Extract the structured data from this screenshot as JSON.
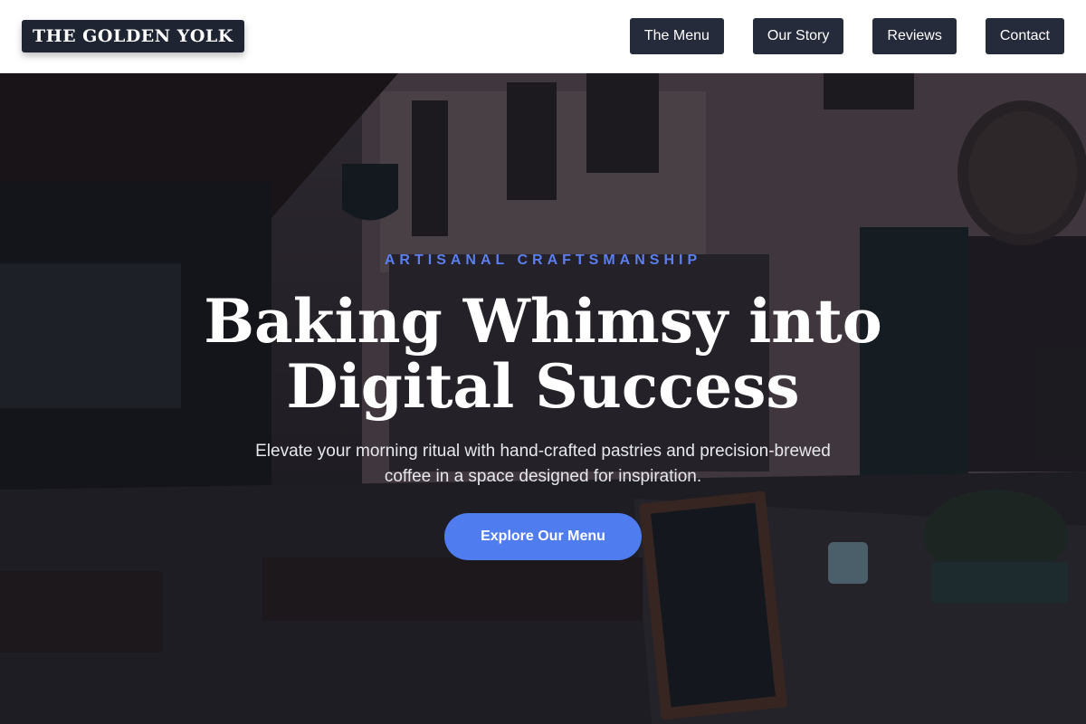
{
  "brand": {
    "name": "THE GOLDEN YOLK"
  },
  "nav": {
    "items": [
      {
        "label": "The Menu"
      },
      {
        "label": "Our Story"
      },
      {
        "label": "Reviews"
      },
      {
        "label": "Contact"
      }
    ]
  },
  "hero": {
    "eyebrow": "ARTISANAL CRAFTSMANSHIP",
    "headline_line1": "Baking Whimsy into",
    "headline_line2": "Digital Success",
    "subtext": "Elevate your morning ritual with hand-crafted pastries and precision-brewed coffee in a space designed for inspiration.",
    "cta_label": "Explore Our Menu",
    "background_image": "cafe-street-photo"
  },
  "colors": {
    "header_bg": "#ffffff",
    "dark_button": "#262b3b",
    "accent": "#4f7df0",
    "eyebrow": "#5b7ff0"
  }
}
